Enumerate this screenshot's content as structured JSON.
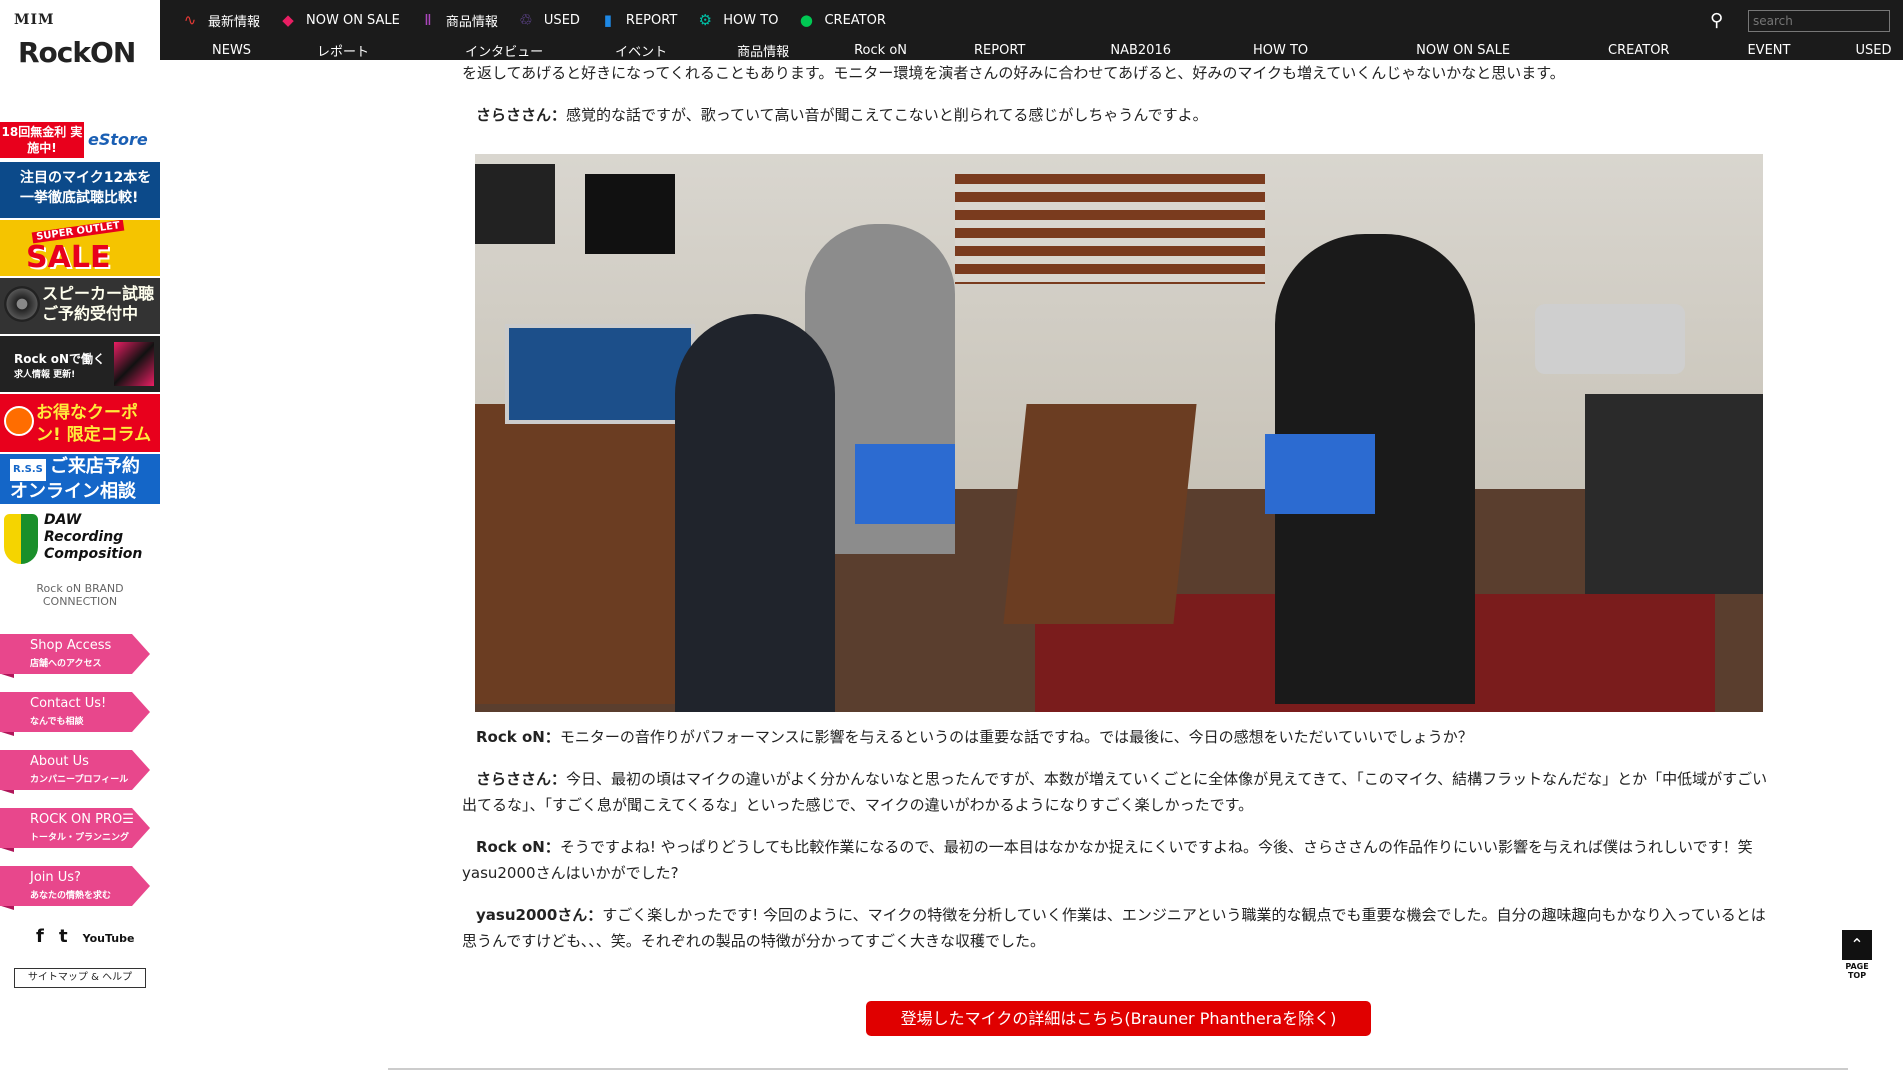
{
  "sidebar": {
    "logo": {
      "mim": "MIM",
      "rockon": "RockON"
    },
    "banners": {
      "estore_red": "18回無金利 実施中!",
      "estore_blue": "eStore",
      "mic": "注目のマイク12本を 一挙徹底試聴比較!",
      "sale_top": "SUPER OUTLET",
      "sale_main": "SALE",
      "speaker": "スピーカー試聴 ご予約受付中",
      "jobs_main": "Rock oNで働く",
      "jobs_sub": "求人情報 更新!",
      "coupon": "お得なクーポン! 限定コラム",
      "shop_rss": "R.S.S",
      "shop": "ご来店予約 オンライン相談",
      "daw": "DAW Recording Composition",
      "brand": "Rock oN BRAND CONNECTION"
    },
    "pink_buttons": [
      {
        "title": "Shop Access",
        "sub": "店舗へのアクセス"
      },
      {
        "title": "Contact Us!",
        "sub": "なんでも相談"
      },
      {
        "title": "About Us",
        "sub": "カンパニープロフィール"
      },
      {
        "title": "ROCK ON PRO☰",
        "sub": "トータル・プランニング"
      },
      {
        "title": "Join Us?",
        "sub": "あなたの情熱を求む"
      }
    ],
    "social": {
      "facebook": "f",
      "twitter": "t",
      "youtube": "YouTube"
    },
    "sitemap": "サイトマップ & ヘルプ"
  },
  "topnav": {
    "primary": [
      {
        "label": "最新情報",
        "icon": "pulse-icon",
        "color": "#e53935"
      },
      {
        "label": "NOW ON SALE",
        "icon": "tag-icon",
        "color": "#e91e63"
      },
      {
        "label": "商品情報",
        "icon": "bars-icon",
        "color": "#ab47bc"
      },
      {
        "label": "USED",
        "icon": "recycle-icon",
        "color": "#7e57c2"
      },
      {
        "label": "REPORT",
        "icon": "mic-icon",
        "color": "#1e88e5"
      },
      {
        "label": "HOW TO",
        "icon": "gear-icon",
        "color": "#00bfa5"
      },
      {
        "label": "CREATOR",
        "icon": "bubble-icon",
        "color": "#00c853"
      }
    ],
    "secondary": [
      "NEWS",
      "レポート",
      "インタビュー",
      "イベント",
      "商品情報",
      "Rock oN",
      "REPORT",
      "NAB2016",
      "HOW TO",
      "NOW ON SALE",
      "CREATOR",
      "EVENT",
      "USED"
    ],
    "search_placeholder": "search"
  },
  "article": {
    "p0_text": "を返してあげると好きになってくれることもあります。モニター環境を演者さんの好みに合わせてあげると、好みのマイクも増えていくんじゃないかなと思います。",
    "p1_speaker": "さらささん：",
    "p1_text": "感覚的な話ですが、歌っていて高い音が聞こえてこないと削られてる感じがしちゃうんですよ。",
    "p2_speaker": "Rock oN：",
    "p2_text": "モニターの音作りがパフォーマンスに影響を与えるというのは重要な話ですね。では最後に、今日の感想をいただいていいでしょうか？",
    "p3_speaker": "さらささん：",
    "p3_text": "今日、最初の頃はマイクの違いがよく分かんないなと思ったんですが、本数が増えていくごとに全体像が見えてきて、「このマイク、結構フラットなんだな」とか「中低域がすごい出てるな」、「すごく息が聞こえてくるな」といった感じで、マイクの違いがわかるようになりすごく楽しかったです。",
    "p4_speaker": "Rock oN：",
    "p4_text": "そうですよね! やっぱりどうしても比較作業になるので、最初の一本目はなかなか捉えにくいですよね。今後、さらささんの作品作りにいい影響を与えれば僕はうれしいです！笑 yasu2000さんはいかがでした?",
    "p5_speaker": "yasu2000さん：",
    "p5_text": "すごく楽しかったです! 今回のように、マイクの特徴を分析していく作業は、エンジニアという職業的な観点でも重要な機会でした。自分の趣味趣向もかなり入っているとは思うんですけども、、、笑。それぞれの製品の特徴が分かってすごく大きな収穫でした。",
    "cta": "登場したマイクの詳細はこちら(Brauner Phantheraを除く)"
  },
  "pagetop": "PAGE TOP"
}
